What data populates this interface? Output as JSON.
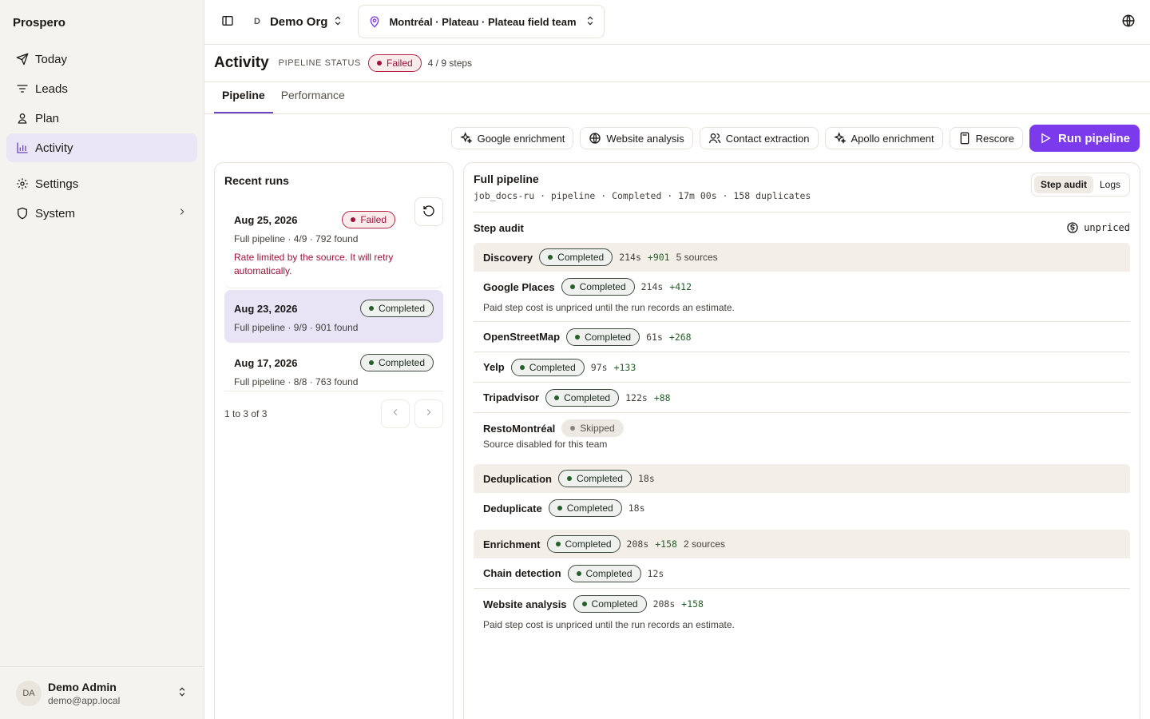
{
  "brand": "Prospero",
  "nav": [
    {
      "label": "Today",
      "icon": "send-icon"
    },
    {
      "label": "Leads",
      "icon": "filter-icon"
    },
    {
      "label": "Plan",
      "icon": "plan-icon"
    },
    {
      "label": "Activity",
      "icon": "chart-icon",
      "active": true
    },
    {
      "label": "Settings",
      "icon": "gear-icon"
    },
    {
      "label": "System",
      "icon": "shield-icon"
    }
  ],
  "user": {
    "initials": "DA",
    "name": "Demo Admin",
    "email": "demo@app.local"
  },
  "topbar": {
    "org_initial": "D",
    "org_name": "Demo Org",
    "scope": "Montréal · Plateau · Plateau field team"
  },
  "header": {
    "title": "Activity",
    "status_label": "PIPELINE STATUS",
    "status": "Failed",
    "steps": "4 / 9 steps"
  },
  "tabs": [
    "Pipeline",
    "Performance"
  ],
  "toolbar": {
    "buttons": [
      "Google enrichment",
      "Website analysis",
      "Contact extraction",
      "Apollo enrichment",
      "Rescore"
    ],
    "run": "Run pipeline"
  },
  "runs": {
    "title": "Recent runs",
    "items": [
      {
        "date": "Aug 25, 2026",
        "status": "Failed",
        "summary": "Full pipeline · 4/9 · 792 found",
        "error": "Rate limited by the source. It will retry automatically."
      },
      {
        "date": "Aug 23, 2026",
        "status": "Completed",
        "summary": "Full pipeline · 9/9 · 901 found"
      },
      {
        "date": "Aug 17, 2026",
        "status": "Completed",
        "summary": "Full pipeline · 8/8 · 763 found"
      }
    ],
    "pager": "1 to 3 of 3"
  },
  "detail": {
    "title": "Full pipeline",
    "meta": "job_docs-ru · pipeline · Completed · 17m 00s · 158 duplicates",
    "seg": [
      "Step audit",
      "Logs"
    ],
    "audit_title": "Step audit",
    "unpriced": "unpriced",
    "note_unpriced": "Paid step cost is unpriced until the run records an estimate.",
    "discovery": {
      "name": "Discovery",
      "status": "Completed",
      "dur": "214s",
      "gain": "+901",
      "src": "5 sources"
    },
    "google": {
      "name": "Google Places",
      "status": "Completed",
      "dur": "214s",
      "gain": "+412"
    },
    "osm": {
      "name": "OpenStreetMap",
      "status": "Completed",
      "dur": "61s",
      "gain": "+268"
    },
    "yelp": {
      "name": "Yelp",
      "status": "Completed",
      "dur": "97s",
      "gain": "+133"
    },
    "trip": {
      "name": "Tripadvisor",
      "status": "Completed",
      "dur": "122s",
      "gain": "+88"
    },
    "resto": {
      "name": "RestoMontréal",
      "status": "Skipped",
      "note": "Source disabled for this team"
    },
    "dedupg": {
      "name": "Deduplication",
      "status": "Completed",
      "dur": "18s"
    },
    "dedup": {
      "name": "Deduplicate",
      "status": "Completed",
      "dur": "18s"
    },
    "enrich": {
      "name": "Enrichment",
      "status": "Completed",
      "dur": "208s",
      "gain": "+158",
      "src": "2 sources"
    },
    "chain": {
      "name": "Chain detection",
      "status": "Completed",
      "dur": "12s"
    },
    "web": {
      "name": "Website analysis",
      "status": "Completed",
      "dur": "208s",
      "gain": "+158"
    }
  }
}
